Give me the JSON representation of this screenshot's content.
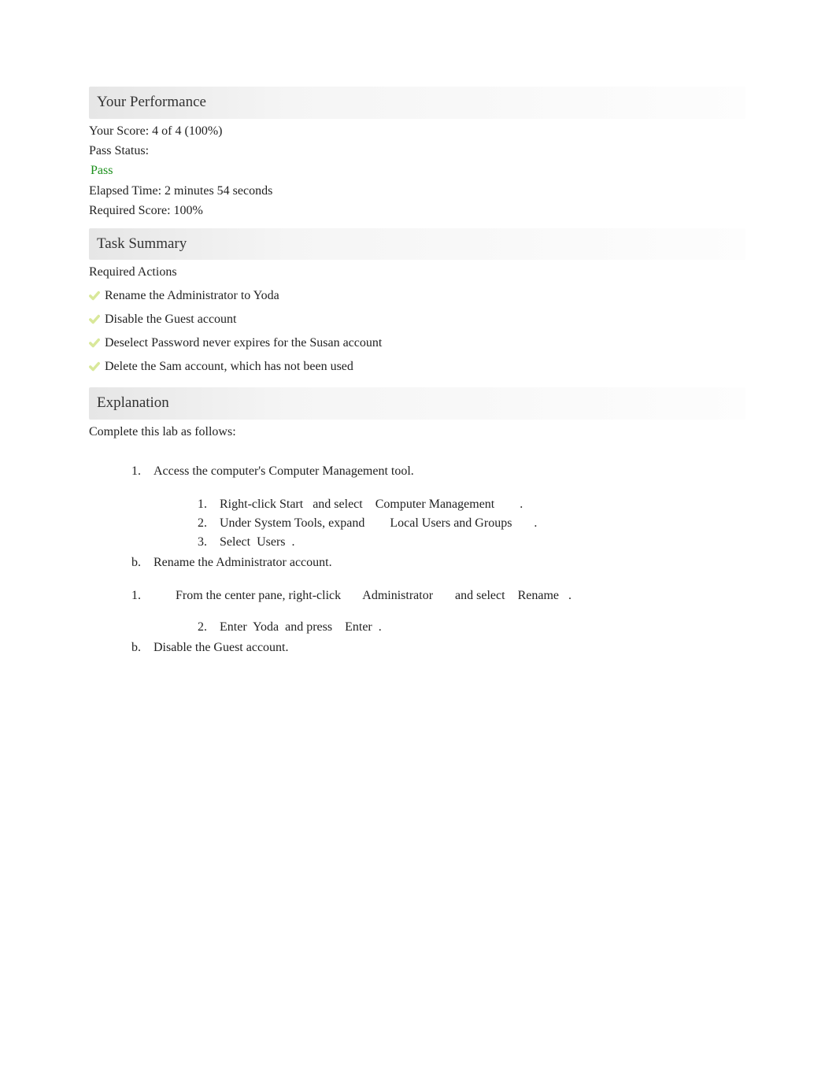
{
  "performance": {
    "header": "Your Performance",
    "score_label": "Your Score: ",
    "score_value": "4 of 4 (100%)",
    "pass_label": "Pass Status:",
    "pass_value": "Pass",
    "elapsed_label": "Elapsed Time: ",
    "elapsed_value": "2 minutes 54 seconds",
    "required_label": "Required Score: ",
    "required_value": "100%"
  },
  "task_summary": {
    "header": "Task Summary",
    "required_label": "Required Actions",
    "actions": [
      "Rename the Administrator to Yoda",
      "Disable the Guest account",
      "Deselect Password never expires for the Susan account",
      "Delete the Sam account, which has not been used"
    ]
  },
  "explanation": {
    "header": "Explanation",
    "intro": "Complete this lab as follows:",
    "steps": {
      "s1_marker": "1.",
      "s1_text": "Access the computer's Computer Management tool.",
      "s1a_marker": "1.",
      "s1a_seg1": "Right-click ",
      "s1a_seg2": "Start",
      "s1a_seg3": "   and select    ",
      "s1a_seg4": "Computer Management",
      "s1a_seg5": "        .",
      "s1b_marker": "2.",
      "s1b_seg1": "Under System Tools, expand        ",
      "s1b_seg2": "Local Users and Groups",
      "s1b_seg3": "       .",
      "s1c_marker": "3.",
      "s1c_seg1": "Select  ",
      "s1c_seg2": "Users",
      "s1c_seg3": "  .",
      "s2_marker": "b.",
      "s2_text": "Rename the Administrator account.",
      "s2a_marker": "1.",
      "s2a_seg1": "From the center pane, right-click       ",
      "s2a_seg2": "Administrator",
      "s2a_seg3": "       and select    ",
      "s2a_seg4": "Rename",
      "s2a_seg5": "   .",
      "s2b_marker": "2.",
      "s2b_seg1": "Enter  ",
      "s2b_seg2": "Yoda",
      "s2b_seg3": "  and press    ",
      "s2b_seg4": "Enter",
      "s2b_seg5": "  .",
      "s3_marker": "b.",
      "s3_text": "Disable the Guest account."
    }
  }
}
